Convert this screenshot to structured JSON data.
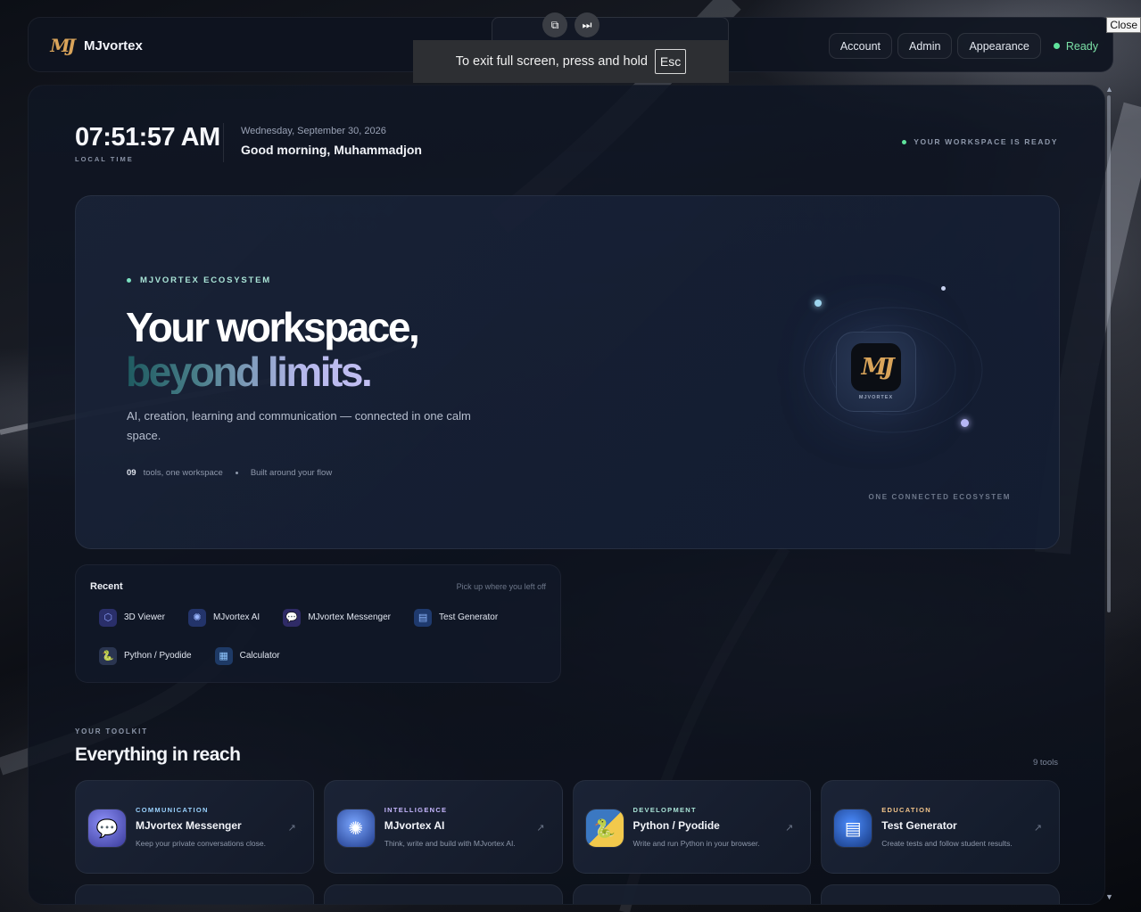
{
  "topbar": {
    "brand_name": "MJvortex",
    "brand_logo_text": "MJ",
    "nav": [
      "Account",
      "Admin",
      "Appearance"
    ],
    "status": "Ready"
  },
  "fullscreen": {
    "message": "To exit full screen, press and hold",
    "key": "Esc",
    "close_tooltip": "Close"
  },
  "header": {
    "time": "07:51:57 AM",
    "time_label": "LOCAL TIME",
    "date": "Wednesday, September 30, 2026",
    "greeting": "Good morning, Muhammadjon",
    "workspace_status": "YOUR WORKSPACE IS READY"
  },
  "hero": {
    "eyebrow": "MJVORTEX ECOSYSTEM",
    "title_line1": "Your workspace,",
    "title_line2": "beyond limits.",
    "subtitle": "AI, creation, learning and communication — connected in one calm space.",
    "tools_count": "09",
    "tools_text": "tools, one workspace",
    "flow_text": "Built around your flow",
    "logo_caption": "MJVORTEX",
    "footer": "ONE CONNECTED ECOSYSTEM"
  },
  "recent": {
    "title": "Recent",
    "hint": "Pick up where you left off",
    "items": [
      {
        "label": "3D Viewer",
        "icon": "cube-icon",
        "color": "#5b6cf0"
      },
      {
        "label": "MJvortex AI",
        "icon": "ai-orb-icon",
        "color": "#6a8df5"
      },
      {
        "label": "MJvortex Messenger",
        "icon": "chat-bubble-icon",
        "color": "#8a7cf0"
      },
      {
        "label": "Test Generator",
        "icon": "test-doc-icon",
        "color": "#3d7df0"
      },
      {
        "label": "Python / Pyodide",
        "icon": "python-icon",
        "color": "#f2c94c"
      },
      {
        "label": "Calculator",
        "icon": "calculator-icon",
        "color": "#4aa3f0"
      }
    ]
  },
  "toolkit": {
    "eyebrow": "YOUR TOOLKIT",
    "title": "Everything in reach",
    "count": "9 tools",
    "cards": [
      {
        "category": "COMMUNICATION",
        "category_color": "#9bd3ff",
        "name": "MJvortex Messenger",
        "desc": "Keep your private conversations close.",
        "icon": "chat-bubble-icon",
        "icon_color": "#7c8cf5"
      },
      {
        "category": "INTELLIGENCE",
        "category_color": "#c7b8ff",
        "name": "MJvortex AI",
        "desc": "Think, write and build with MJvortex AI.",
        "icon": "ai-brain-icon",
        "icon_color": "#4f7ae8"
      },
      {
        "category": "DEVELOPMENT",
        "category_color": "#a9e3d6",
        "name": "Python / Pyodide",
        "desc": "Write and run Python in your browser.",
        "icon": "python-icon",
        "icon_color": "#3b78c2"
      },
      {
        "category": "EDUCATION",
        "category_color": "#f2c48a",
        "name": "Test Generator",
        "desc": "Create tests and follow student results.",
        "icon": "test-doc-icon",
        "icon_color": "#2f6fd8"
      }
    ]
  }
}
